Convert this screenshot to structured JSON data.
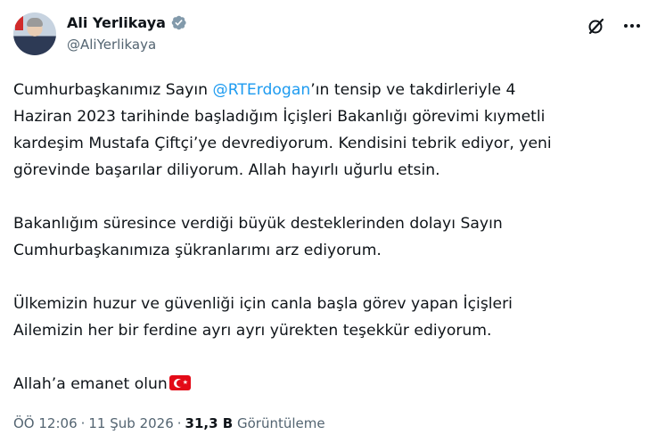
{
  "author": {
    "display_name": "Ali Yerlikaya",
    "handle": "@AliYerlikaya"
  },
  "icons": [
    "verified-badge-icon",
    "grok-icon",
    "more-icon"
  ],
  "tweet": {
    "p1_before": "Cumhurbaşkanımız Sayın ",
    "mention": "@RTErdogan",
    "p1_l1_after": "’ın tensip ve takdirleriyle 4",
    "p1_l2": "Haziran 2023 tarihinde başladığım İçişleri Bakanlığı görevimi kıymetli",
    "p1_l3": "kardeşim Mustafa Çiftçi’ye devrediyorum. Kendisini tebrik ediyor, yeni",
    "p1_l4": "görevinde başarılar diliyorum. Allah hayırlı uğurlu etsin.",
    "p2_l1": "Bakanlığım süresince verdiği büyük desteklerinden dolayı Sayın",
    "p2_l2": "Cumhurbaşkanımıza şükranlarımı arz ediyorum.",
    "p3_l1": "Ülkemizin huzur ve güvenliği için canla başla görev yapan İçişleri",
    "p3_l2": "Ailemizin her bir ferdine ayrı ayrı yürekten teşekkür ediyorum.",
    "p4": "Allah’a emanet olun"
  },
  "meta": {
    "time": "ÖÖ 12:06",
    "separator": "·",
    "date": "11 Şub 2026",
    "views_count": "31,3 B",
    "views_label": "Görüntüleme"
  },
  "colors": {
    "text": "#0f1419",
    "secondary": "#536471",
    "accent": "#1d9bf0"
  }
}
